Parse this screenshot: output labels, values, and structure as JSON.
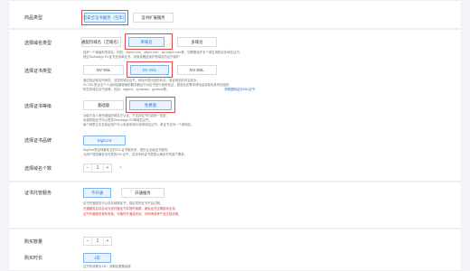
{
  "product_type": {
    "label": "商品类型",
    "options": [
      "云安全证书服务（包年）",
      "证书扩展服务"
    ]
  },
  "domain_type": {
    "label": "选择域名类型",
    "options": [
      "通配符域名（泛域名）",
      "单域名",
      "多域名"
    ],
    "desc": [
      "保护一个单级别的域名，例如：aliyun.com、aliyun.com、api.aliyun.com等，如需要保护多个域名请购买多域名证书。",
      "超过Globalsign DV证书支持单证书，将免费赠送保护根域名的证书保护"
    ]
  },
  "cert_type": {
    "label": "选择证书类型",
    "options": [
      "OV SSL",
      "DV SSL",
      "EV SSL"
    ],
    "desc": [
      "通过验证域名所有权，当您的域名证书，网站可显示锁形标志，保证网站的内容安全。",
      "DV SSL是企业个人及网站最基础的服务器证书对证书进行身份验证，颁发给无需申请电话或者传真号的组织。",
      "知名的域名证书品牌，包括：digicert、symantec、geotrust等。"
    ],
    "desc_tail": "请根据网站对SSL证书"
  },
  "cert_level": {
    "label": "选择证书等级",
    "options": [
      "基础版",
      "免费版"
    ],
    "desc": [
      "功能不含人身份被接的域名已认证，不支持证书内容统一加密。",
      "免费获取证书可以签发Globalsign DV单域名证书。",
      "每个阿里云实名验证用户可以免费申请20张单域名证书，单证书支持一个单域名。"
    ]
  },
  "brand": {
    "label": "选择证书品牌",
    "value": "DigiCert",
    "desc": [
      "DigiCert是全球最知名的SSL证书服务商，提供企业级证书服务。",
      "为用户提供最安全可靠的SSL证书，支持多种证书类型以满足不同用户需求。"
    ]
  },
  "domain_count": {
    "label": "选择域名个数",
    "value": "1",
    "help": "?"
  },
  "service": {
    "label": "证书托管服务",
    "options": [
      "不开通",
      "开通服务"
    ],
    "desc": [
      "证书托管服务可以自动续期证书，保证您的证书不会过期。",
      "开通服务后将自动为您托管证书并按时续期，避免证书过期影响业务。",
      "证书托管服务按年收费，可随时开通或关闭，详情请参考产品文档说明。"
    ]
  },
  "quantity": {
    "label": "购买数量",
    "value": "1"
  },
  "duration": {
    "label": "购买时长",
    "option": "1年",
    "desc": "证书有效期为1年，到期后需要续费"
  },
  "colors": {
    "accent": "#2a7ad8",
    "highlight": "#e24a4a",
    "active_bg": "#e9f3ff"
  }
}
